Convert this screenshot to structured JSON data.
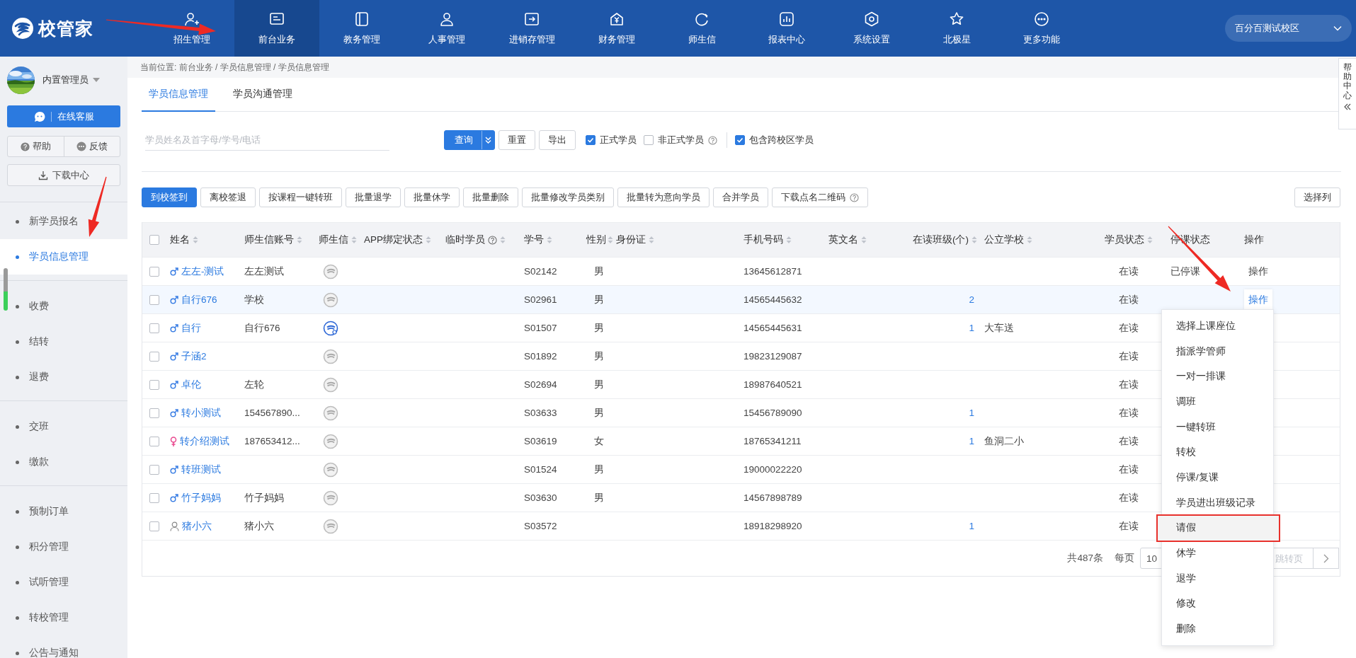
{
  "logo": "校管家",
  "nav": [
    {
      "label": "招生管理",
      "selected": false
    },
    {
      "label": "前台业务",
      "selected": true
    },
    {
      "label": "教务管理",
      "selected": false
    },
    {
      "label": "人事管理",
      "selected": false
    },
    {
      "label": "进销存管理",
      "selected": false
    },
    {
      "label": "财务管理",
      "selected": false
    },
    {
      "label": "师生信",
      "selected": false
    },
    {
      "label": "报表中心",
      "selected": false
    },
    {
      "label": "系统设置",
      "selected": false
    },
    {
      "label": "北极星",
      "selected": false
    },
    {
      "label": "更多功能",
      "selected": false
    }
  ],
  "campus": "百分百测试校区",
  "sidebar": {
    "user": "内置管理员",
    "service_button": "在线客服",
    "help_button": "帮助",
    "feedback_button": "反馈",
    "download_button": "下载中心",
    "groups": [
      [
        {
          "label": "新学员报名",
          "selected": false
        },
        {
          "label": "学员信息管理",
          "selected": true
        }
      ],
      [
        {
          "label": "收费",
          "selected": false
        },
        {
          "label": "结转",
          "selected": false
        },
        {
          "label": "退费",
          "selected": false
        }
      ],
      [
        {
          "label": "交班",
          "selected": false
        },
        {
          "label": "缴款",
          "selected": false
        }
      ],
      [
        {
          "label": "预制订单",
          "selected": false
        },
        {
          "label": "积分管理",
          "selected": false
        },
        {
          "label": "试听管理",
          "selected": false
        },
        {
          "label": "转校管理",
          "selected": false
        },
        {
          "label": "公告与通知",
          "selected": false
        }
      ]
    ]
  },
  "breadcrumb": "当前位置:  前台业务 / 学员信息管理 / 学员信息管理",
  "tabs": [
    {
      "label": "学员信息管理",
      "selected": true
    },
    {
      "label": "学员沟通管理",
      "selected": false
    }
  ],
  "help_tab": "帮助中心",
  "search": {
    "placeholder": "学员姓名及首字母/学号/电话"
  },
  "filter_buttons": [
    {
      "label": "查询",
      "kind": "split"
    },
    {
      "label": "重置",
      "kind": "default"
    },
    {
      "label": "导出",
      "kind": "default"
    }
  ],
  "filter_checks": [
    {
      "label": "正式学员",
      "checked": true,
      "help": false
    },
    {
      "label": "非正式学员",
      "checked": false,
      "help": true
    },
    {
      "label": "包含跨校区学员",
      "checked": true,
      "help": false
    }
  ],
  "actions": [
    {
      "label": "到校签到",
      "primary": true,
      "help": false
    },
    {
      "label": "离校签退",
      "primary": false,
      "help": false
    },
    {
      "label": "按课程一键转班",
      "primary": false,
      "help": false
    },
    {
      "label": "批量退学",
      "primary": false,
      "help": false
    },
    {
      "label": "批量休学",
      "primary": false,
      "help": false
    },
    {
      "label": "批量删除",
      "primary": false,
      "help": false
    },
    {
      "label": "批量修改学员类别",
      "primary": false,
      "help": false
    },
    {
      "label": "批量转为意向学员",
      "primary": false,
      "help": false
    },
    {
      "label": "合并学员",
      "primary": false,
      "help": false
    },
    {
      "label": "下载点名二维码",
      "primary": false,
      "help": true
    }
  ],
  "column_chooser": "选择列",
  "table": {
    "select_all": {
      "checked": false
    },
    "columns": [
      {
        "label": "姓名",
        "sortable": true,
        "help": false
      },
      {
        "label": "师生信账号",
        "sortable": true,
        "help": false
      },
      {
        "label": "师生信",
        "sortable": true,
        "help": false
      },
      {
        "label": "APP绑定状态",
        "sortable": true,
        "help": false
      },
      {
        "label": "临时学员",
        "sortable": true,
        "help": true
      },
      {
        "label": "学号",
        "sortable": true,
        "help": false
      },
      {
        "label": "性别",
        "sortable": true,
        "help": false
      },
      {
        "label": "身份证",
        "sortable": true,
        "help": false
      },
      {
        "label": "手机号码",
        "sortable": true,
        "help": false
      },
      {
        "label": "英文名",
        "sortable": true,
        "help": false
      },
      {
        "label": "在读班级(个)",
        "sortable": true,
        "help": false
      },
      {
        "label": "公立学校",
        "sortable": true,
        "help": false
      },
      {
        "label": "学员状态",
        "sortable": true,
        "help": false
      },
      {
        "label": "停课状态",
        "sortable": false,
        "help": false
      },
      {
        "label": "操作",
        "sortable": false,
        "help": false
      }
    ],
    "rows": [
      {
        "checked": false,
        "selected": false,
        "kind": "male",
        "name": "左左-测试",
        "account": "左左测试",
        "app_bound": false,
        "student_no": "S02142",
        "sex": "男",
        "phone": "13645612871",
        "status": "在读",
        "suspend": "已停课",
        "action": "操作"
      },
      {
        "checked": false,
        "selected": true,
        "kind": "male",
        "name": "自行676",
        "account": "学校",
        "app_bound": false,
        "student_no": "S02961",
        "sex": "男",
        "phone": "14565445632",
        "classes": "2",
        "status": "在读",
        "action": "操作"
      },
      {
        "checked": false,
        "selected": false,
        "kind": "male",
        "name": "自行",
        "account": "自行676",
        "app_bound": true,
        "student_no": "S01507",
        "sex": "男",
        "phone": "14565445631",
        "classes": "1",
        "school": "大车送",
        "status": "在读"
      },
      {
        "checked": false,
        "selected": false,
        "kind": "male",
        "name": "子涵2",
        "app_bound": false,
        "student_no": "S01892",
        "sex": "男",
        "phone": "19823129087",
        "status": "在读"
      },
      {
        "checked": false,
        "selected": false,
        "kind": "male",
        "name": "卓伦",
        "account": "左轮",
        "app_bound": false,
        "student_no": "S02694",
        "sex": "男",
        "phone": "18987640521",
        "status": "在读"
      },
      {
        "checked": false,
        "selected": false,
        "kind": "male",
        "name": "转小测试",
        "account": "154567890...",
        "app_bound": false,
        "student_no": "S03633",
        "sex": "男",
        "phone": "15456789090",
        "classes": "1",
        "status": "在读"
      },
      {
        "checked": false,
        "selected": false,
        "kind": "female",
        "name": "转介绍测试",
        "account": "187653412...",
        "app_bound": false,
        "student_no": "S03619",
        "sex": "女",
        "phone": "18765341211",
        "classes": "1",
        "school": "鱼洞二小",
        "status": "在读"
      },
      {
        "checked": false,
        "selected": false,
        "kind": "male",
        "name": "转班测试",
        "app_bound": false,
        "student_no": "S01524",
        "sex": "男",
        "phone": "19000022220",
        "status": "在读"
      },
      {
        "checked": false,
        "selected": false,
        "kind": "male",
        "name": "竹子妈妈",
        "account": "竹子妈妈",
        "app_bound": false,
        "student_no": "S03630",
        "sex": "男",
        "phone": "14567898789",
        "status": "在读"
      },
      {
        "checked": false,
        "selected": false,
        "kind": "unknown",
        "name": "猪小六",
        "account": "猪小六",
        "app_bound": false,
        "student_no": "S03572",
        "phone": "18918298920",
        "classes": "1",
        "status": "在读"
      }
    ]
  },
  "pagination": {
    "total": "共487条",
    "per_page_label": "每页",
    "page_size": "10",
    "jump_placeholder": "跳转页"
  },
  "action_menu": [
    {
      "label": "选择上课座位",
      "marked": false
    },
    {
      "label": "指派学管师",
      "marked": false
    },
    {
      "label": "一对一排课",
      "marked": false
    },
    {
      "label": "调班",
      "marked": false
    },
    {
      "label": "一键转班",
      "marked": false
    },
    {
      "label": "转校",
      "marked": false
    },
    {
      "label": "停课/复课",
      "marked": false
    },
    {
      "label": "学员进出班级记录",
      "marked": false
    },
    {
      "label": "请假",
      "marked": true
    },
    {
      "label": "休学",
      "marked": false
    },
    {
      "label": "退学",
      "marked": false
    },
    {
      "label": "修改",
      "marked": false
    },
    {
      "label": "删除",
      "marked": false
    }
  ]
}
